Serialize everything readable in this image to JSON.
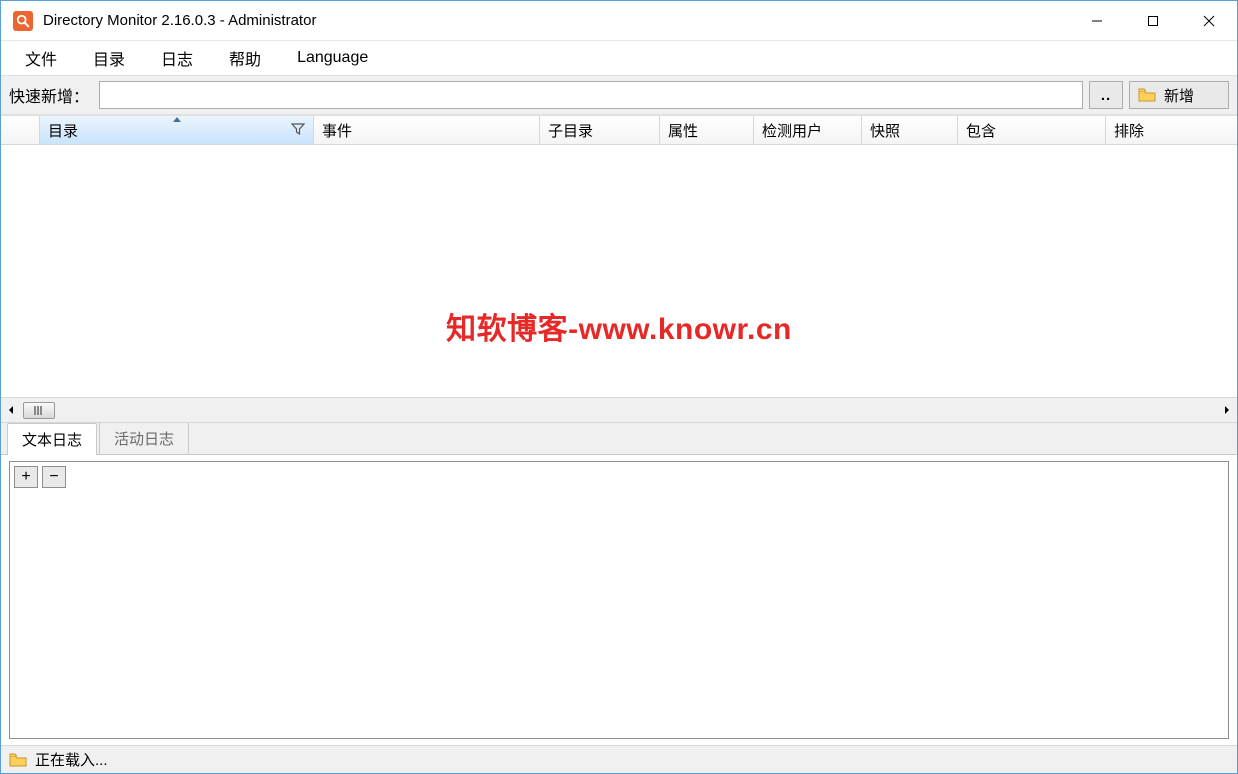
{
  "title": "Directory Monitor 2.16.0.3 - Administrator",
  "menu": {
    "file": "文件",
    "directory": "目录",
    "log": "日志",
    "help": "帮助",
    "language": "Language"
  },
  "quick": {
    "label": "快速新增：",
    "value": "",
    "browse": "..",
    "add_label": "新增"
  },
  "columns": {
    "c0": "",
    "c1": "目录",
    "c2": "事件",
    "c3": "子目录",
    "c4": "属性",
    "c5": "检测用户",
    "c6": "快照",
    "c7": "包含",
    "c8": "排除"
  },
  "watermark": "知软博客-www.knowr.cn",
  "tabs": {
    "text_log": "文本日志",
    "activity_log": "活动日志"
  },
  "log_buttons": {
    "plus": "+",
    "minus": "−"
  },
  "status": {
    "loading": "正在载入..."
  }
}
